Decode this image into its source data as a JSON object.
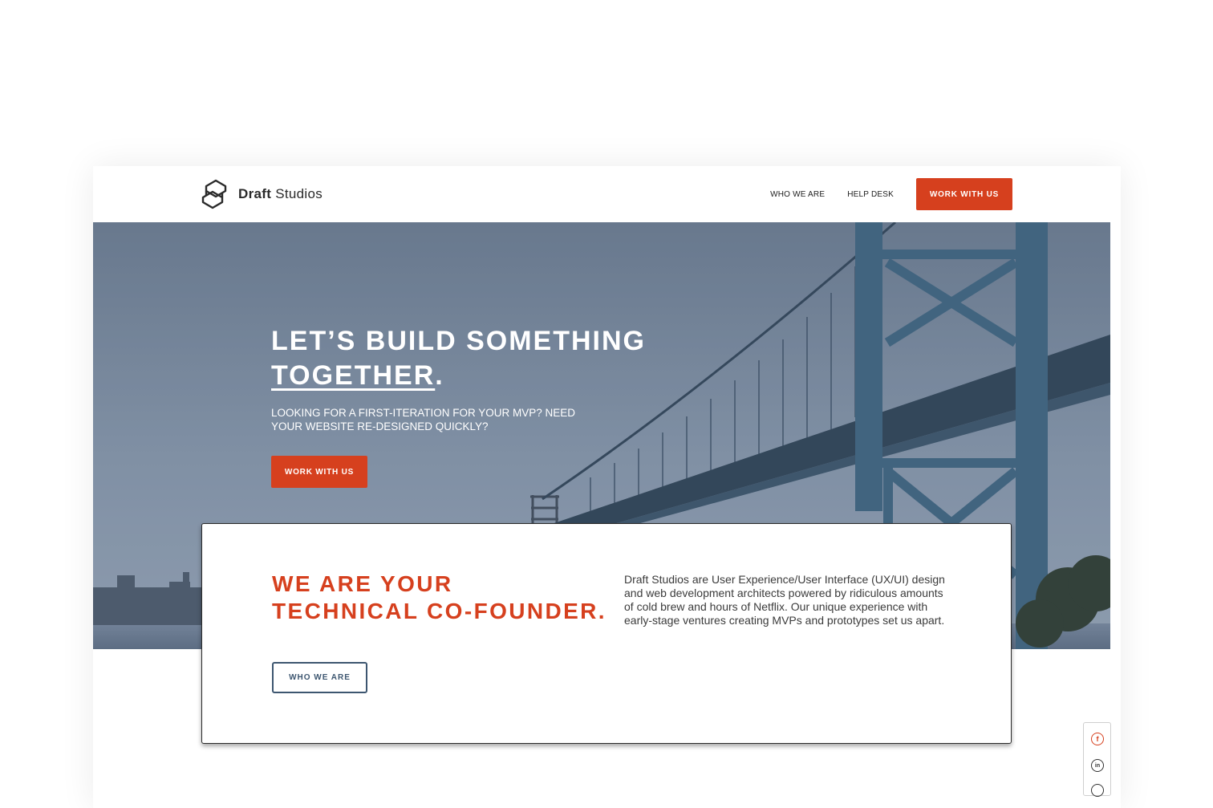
{
  "header": {
    "logo_bold": "Draft",
    "logo_light": " Studios",
    "nav": [
      {
        "label": "WHO WE ARE"
      },
      {
        "label": "HELP DESK"
      }
    ],
    "cta_label": "WORK WITH US"
  },
  "hero": {
    "title_line1": "LET’S BUILD SOMETHING",
    "title_underlined": "TOGETHER",
    "title_end": ".",
    "subtitle": "LOOKING FOR A FIRST-ITERATION FOR YOUR MVP? NEED YOUR WEBSITE RE-DESIGNED QUICKLY?",
    "cta_label": "WORK WITH US"
  },
  "card": {
    "heading_line1": "WE ARE YOUR",
    "heading_line2": "TECHNICAL CO-FOUNDER.",
    "body": "Draft Studios are User Experience/User Interface (UX/UI) design and web development architects powered by ridiculous amounts of cold brew and hours of Netflix. Our unique experience with early-stage ventures creating MVPs and prototypes set us apart.",
    "button_label": "WHO WE ARE"
  },
  "social": {
    "icons": [
      "facebook-icon",
      "linkedin-icon",
      "instagram-icon"
    ],
    "facebook_glyph": "f",
    "linkedin_glyph": "in"
  },
  "colors": {
    "accent": "#d6401e",
    "outline_button": "#3d5670",
    "text_dark": "#1d1d1d"
  }
}
